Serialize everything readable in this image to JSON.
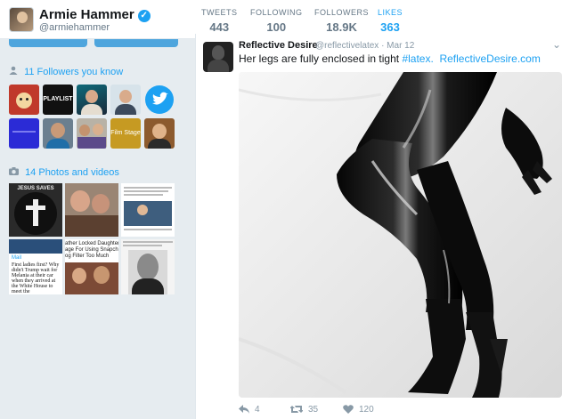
{
  "profile": {
    "name": "Armie Hammer",
    "handle": "@armiehammer",
    "verified_icon": "verified-badge-icon"
  },
  "stats": [
    {
      "label": "TWEETS",
      "value": "443"
    },
    {
      "label": "FOLLOWING",
      "value": "100"
    },
    {
      "label": "FOLLOWERS",
      "value": "18.9K"
    },
    {
      "label": "LIKES",
      "value": "363"
    }
  ],
  "sidebar": {
    "followers_title": "11 Followers you know",
    "followers_icon": "person-icon",
    "photos_title": "14 Photos and videos",
    "photos_icon": "camera-icon",
    "follower_tiles": [
      {
        "name": "follower-dog",
        "text": ""
      },
      {
        "name": "follower-playlist",
        "text": "PLAYLIST"
      },
      {
        "name": "follower-person-1",
        "text": ""
      },
      {
        "name": "follower-person-2",
        "text": ""
      },
      {
        "name": "follower-twitter",
        "text": ""
      },
      {
        "name": "follower-blue",
        "text": ""
      },
      {
        "name": "follower-person-3",
        "text": ""
      },
      {
        "name": "follower-couple",
        "text": ""
      },
      {
        "name": "follower-filmstage",
        "text": "Film Stage"
      },
      {
        "name": "follower-person-4",
        "text": ""
      }
    ],
    "photo_texts": {
      "jesus": "JESUS SAVES",
      "daughter": "ather Locked Daughter\nage For Using Snapchat\nog Filter Too Much",
      "melania": "First ladies first? Why didn't Trump wait for Melania at their car when they arrived at the White House to meet the",
      "news_label": "Mail"
    }
  },
  "tweet": {
    "author": "Reflective Desire",
    "handle_time": "@reflectivelatex · Mar 12",
    "text_plain": "Her legs are fully enclosed in tight ",
    "hashtag": "#latex.",
    "link": "ReflectiveDesire.com",
    "actions": {
      "reply": "4",
      "retweet": "35",
      "like": "120"
    }
  },
  "colors": {
    "accent": "#1da1f2",
    "background": "#e6ecf0"
  }
}
